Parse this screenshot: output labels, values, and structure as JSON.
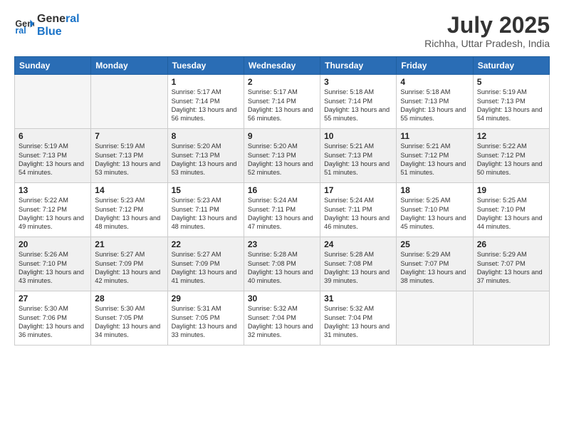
{
  "header": {
    "logo_line1": "General",
    "logo_line2": "Blue",
    "month_year": "July 2025",
    "location": "Richha, Uttar Pradesh, India"
  },
  "weekdays": [
    "Sunday",
    "Monday",
    "Tuesday",
    "Wednesday",
    "Thursday",
    "Friday",
    "Saturday"
  ],
  "weeks": [
    [
      {
        "day": "",
        "sunrise": "",
        "sunset": "",
        "daylight": ""
      },
      {
        "day": "",
        "sunrise": "",
        "sunset": "",
        "daylight": ""
      },
      {
        "day": "1",
        "sunrise": "Sunrise: 5:17 AM",
        "sunset": "Sunset: 7:14 PM",
        "daylight": "Daylight: 13 hours and 56 minutes."
      },
      {
        "day": "2",
        "sunrise": "Sunrise: 5:17 AM",
        "sunset": "Sunset: 7:14 PM",
        "daylight": "Daylight: 13 hours and 56 minutes."
      },
      {
        "day": "3",
        "sunrise": "Sunrise: 5:18 AM",
        "sunset": "Sunset: 7:14 PM",
        "daylight": "Daylight: 13 hours and 55 minutes."
      },
      {
        "day": "4",
        "sunrise": "Sunrise: 5:18 AM",
        "sunset": "Sunset: 7:13 PM",
        "daylight": "Daylight: 13 hours and 55 minutes."
      },
      {
        "day": "5",
        "sunrise": "Sunrise: 5:19 AM",
        "sunset": "Sunset: 7:13 PM",
        "daylight": "Daylight: 13 hours and 54 minutes."
      }
    ],
    [
      {
        "day": "6",
        "sunrise": "Sunrise: 5:19 AM",
        "sunset": "Sunset: 7:13 PM",
        "daylight": "Daylight: 13 hours and 54 minutes."
      },
      {
        "day": "7",
        "sunrise": "Sunrise: 5:19 AM",
        "sunset": "Sunset: 7:13 PM",
        "daylight": "Daylight: 13 hours and 53 minutes."
      },
      {
        "day": "8",
        "sunrise": "Sunrise: 5:20 AM",
        "sunset": "Sunset: 7:13 PM",
        "daylight": "Daylight: 13 hours and 53 minutes."
      },
      {
        "day": "9",
        "sunrise": "Sunrise: 5:20 AM",
        "sunset": "Sunset: 7:13 PM",
        "daylight": "Daylight: 13 hours and 52 minutes."
      },
      {
        "day": "10",
        "sunrise": "Sunrise: 5:21 AM",
        "sunset": "Sunset: 7:13 PM",
        "daylight": "Daylight: 13 hours and 51 minutes."
      },
      {
        "day": "11",
        "sunrise": "Sunrise: 5:21 AM",
        "sunset": "Sunset: 7:12 PM",
        "daylight": "Daylight: 13 hours and 51 minutes."
      },
      {
        "day": "12",
        "sunrise": "Sunrise: 5:22 AM",
        "sunset": "Sunset: 7:12 PM",
        "daylight": "Daylight: 13 hours and 50 minutes."
      }
    ],
    [
      {
        "day": "13",
        "sunrise": "Sunrise: 5:22 AM",
        "sunset": "Sunset: 7:12 PM",
        "daylight": "Daylight: 13 hours and 49 minutes."
      },
      {
        "day": "14",
        "sunrise": "Sunrise: 5:23 AM",
        "sunset": "Sunset: 7:12 PM",
        "daylight": "Daylight: 13 hours and 48 minutes."
      },
      {
        "day": "15",
        "sunrise": "Sunrise: 5:23 AM",
        "sunset": "Sunset: 7:11 PM",
        "daylight": "Daylight: 13 hours and 48 minutes."
      },
      {
        "day": "16",
        "sunrise": "Sunrise: 5:24 AM",
        "sunset": "Sunset: 7:11 PM",
        "daylight": "Daylight: 13 hours and 47 minutes."
      },
      {
        "day": "17",
        "sunrise": "Sunrise: 5:24 AM",
        "sunset": "Sunset: 7:11 PM",
        "daylight": "Daylight: 13 hours and 46 minutes."
      },
      {
        "day": "18",
        "sunrise": "Sunrise: 5:25 AM",
        "sunset": "Sunset: 7:10 PM",
        "daylight": "Daylight: 13 hours and 45 minutes."
      },
      {
        "day": "19",
        "sunrise": "Sunrise: 5:25 AM",
        "sunset": "Sunset: 7:10 PM",
        "daylight": "Daylight: 13 hours and 44 minutes."
      }
    ],
    [
      {
        "day": "20",
        "sunrise": "Sunrise: 5:26 AM",
        "sunset": "Sunset: 7:10 PM",
        "daylight": "Daylight: 13 hours and 43 minutes."
      },
      {
        "day": "21",
        "sunrise": "Sunrise: 5:27 AM",
        "sunset": "Sunset: 7:09 PM",
        "daylight": "Daylight: 13 hours and 42 minutes."
      },
      {
        "day": "22",
        "sunrise": "Sunrise: 5:27 AM",
        "sunset": "Sunset: 7:09 PM",
        "daylight": "Daylight: 13 hours and 41 minutes."
      },
      {
        "day": "23",
        "sunrise": "Sunrise: 5:28 AM",
        "sunset": "Sunset: 7:08 PM",
        "daylight": "Daylight: 13 hours and 40 minutes."
      },
      {
        "day": "24",
        "sunrise": "Sunrise: 5:28 AM",
        "sunset": "Sunset: 7:08 PM",
        "daylight": "Daylight: 13 hours and 39 minutes."
      },
      {
        "day": "25",
        "sunrise": "Sunrise: 5:29 AM",
        "sunset": "Sunset: 7:07 PM",
        "daylight": "Daylight: 13 hours and 38 minutes."
      },
      {
        "day": "26",
        "sunrise": "Sunrise: 5:29 AM",
        "sunset": "Sunset: 7:07 PM",
        "daylight": "Daylight: 13 hours and 37 minutes."
      }
    ],
    [
      {
        "day": "27",
        "sunrise": "Sunrise: 5:30 AM",
        "sunset": "Sunset: 7:06 PM",
        "daylight": "Daylight: 13 hours and 36 minutes."
      },
      {
        "day": "28",
        "sunrise": "Sunrise: 5:30 AM",
        "sunset": "Sunset: 7:05 PM",
        "daylight": "Daylight: 13 hours and 34 minutes."
      },
      {
        "day": "29",
        "sunrise": "Sunrise: 5:31 AM",
        "sunset": "Sunset: 7:05 PM",
        "daylight": "Daylight: 13 hours and 33 minutes."
      },
      {
        "day": "30",
        "sunrise": "Sunrise: 5:32 AM",
        "sunset": "Sunset: 7:04 PM",
        "daylight": "Daylight: 13 hours and 32 minutes."
      },
      {
        "day": "31",
        "sunrise": "Sunrise: 5:32 AM",
        "sunset": "Sunset: 7:04 PM",
        "daylight": "Daylight: 13 hours and 31 minutes."
      },
      {
        "day": "",
        "sunrise": "",
        "sunset": "",
        "daylight": ""
      },
      {
        "day": "",
        "sunrise": "",
        "sunset": "",
        "daylight": ""
      }
    ]
  ]
}
